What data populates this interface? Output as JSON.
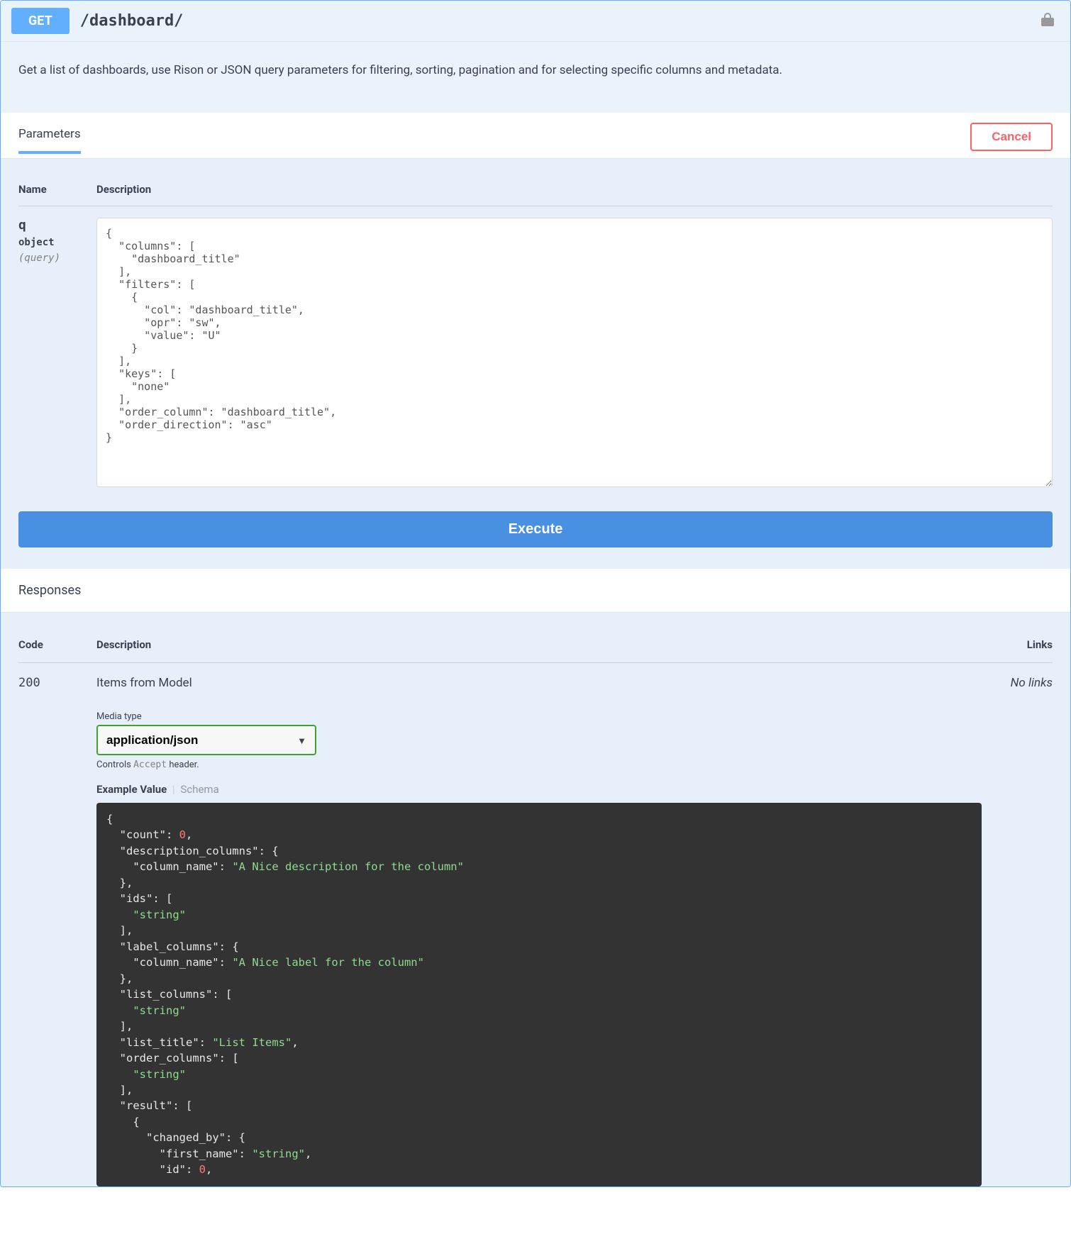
{
  "endpoint": {
    "method": "GET",
    "path": "/dashboard/",
    "summary": "Get a list of dashboards, use Rison or JSON query parameters for filtering, sorting, pagination and for selecting specific columns and metadata."
  },
  "tabs": {
    "parameters": "Parameters",
    "cancel": "Cancel"
  },
  "param_headers": {
    "name": "Name",
    "description": "Description"
  },
  "parameter": {
    "name": "q",
    "type": "object",
    "location": "(query)",
    "body": "{\n  \"columns\": [\n    \"dashboard_title\"\n  ],\n  \"filters\": [\n    {\n      \"col\": \"dashboard_title\",\n      \"opr\": \"sw\",\n      \"value\": \"U\"\n    }\n  ],\n  \"keys\": [\n    \"none\"\n  ],\n  \"order_column\": \"dashboard_title\",\n  \"order_direction\": \"asc\"\n}"
  },
  "buttons": {
    "execute": "Execute"
  },
  "responses": {
    "heading": "Responses",
    "headers": {
      "code": "Code",
      "description": "Description",
      "links": "Links"
    },
    "row": {
      "code": "200",
      "title": "Items from Model",
      "links": "No links",
      "media_label": "Media type",
      "media_type": "application/json",
      "controls_pre": "Controls",
      "controls_accept": "Accept",
      "controls_post": "header.",
      "tab_example": "Example Value",
      "tab_schema": "Schema"
    },
    "example": {
      "count": 0,
      "description_columns": {
        "column_name": "A Nice description for the column"
      },
      "ids": [
        "string"
      ],
      "label_columns": {
        "column_name": "A Nice label for the column"
      },
      "list_columns": [
        "string"
      ],
      "list_title": "List Items",
      "order_columns": [
        "string"
      ],
      "result_changed_by_first_name": "string",
      "result_changed_by_id": 0
    }
  }
}
